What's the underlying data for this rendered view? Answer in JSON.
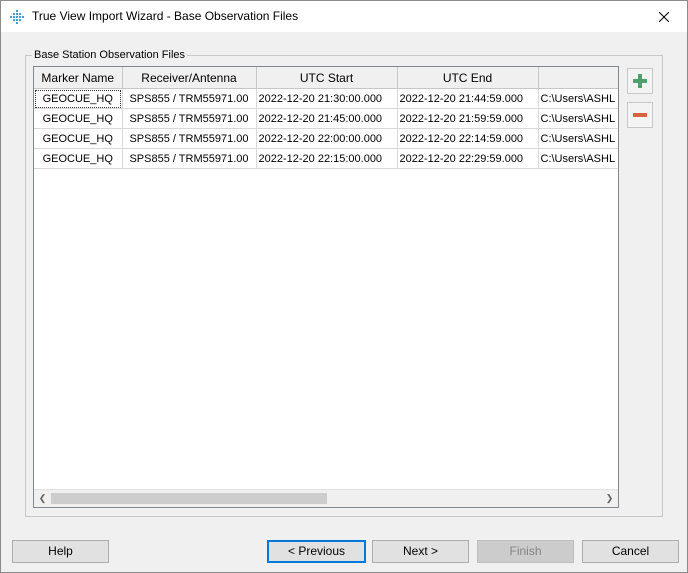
{
  "window": {
    "title": "True View Import Wizard - Base Observation Files"
  },
  "group": {
    "label": "Base Station Observation Files"
  },
  "table": {
    "columns": [
      "Marker Name",
      "Receiver/Antenna",
      "UTC Start",
      "UTC End",
      ""
    ],
    "rows": [
      [
        "GEOCUE_HQ",
        "SPS855 / TRM55971.00",
        "2022-12-20 21:30:00.000",
        "2022-12-20 21:44:59.000",
        "C:\\Users\\ASHL"
      ],
      [
        "GEOCUE_HQ",
        "SPS855 / TRM55971.00",
        "2022-12-20 21:45:00.000",
        "2022-12-20 21:59:59.000",
        "C:\\Users\\ASHL"
      ],
      [
        "GEOCUE_HQ",
        "SPS855 / TRM55971.00",
        "2022-12-20 22:00:00.000",
        "2022-12-20 22:14:59.000",
        "C:\\Users\\ASHL"
      ],
      [
        "GEOCUE_HQ",
        "SPS855 / TRM55971.00",
        "2022-12-20 22:15:00.000",
        "2022-12-20 22:29:59.000",
        "C:\\Users\\ASHL"
      ]
    ],
    "horizontal_scroll_fraction": 0.0
  },
  "side_buttons": {
    "add_icon": "plus-icon",
    "remove_icon": "minus-icon"
  },
  "footer": {
    "help": "Help",
    "previous": "< Previous",
    "next": "Next >",
    "finish": "Finish",
    "cancel": "Cancel"
  },
  "colors": {
    "add": "#4ca16b",
    "remove": "#d9633f",
    "focus": "#0078d7"
  }
}
